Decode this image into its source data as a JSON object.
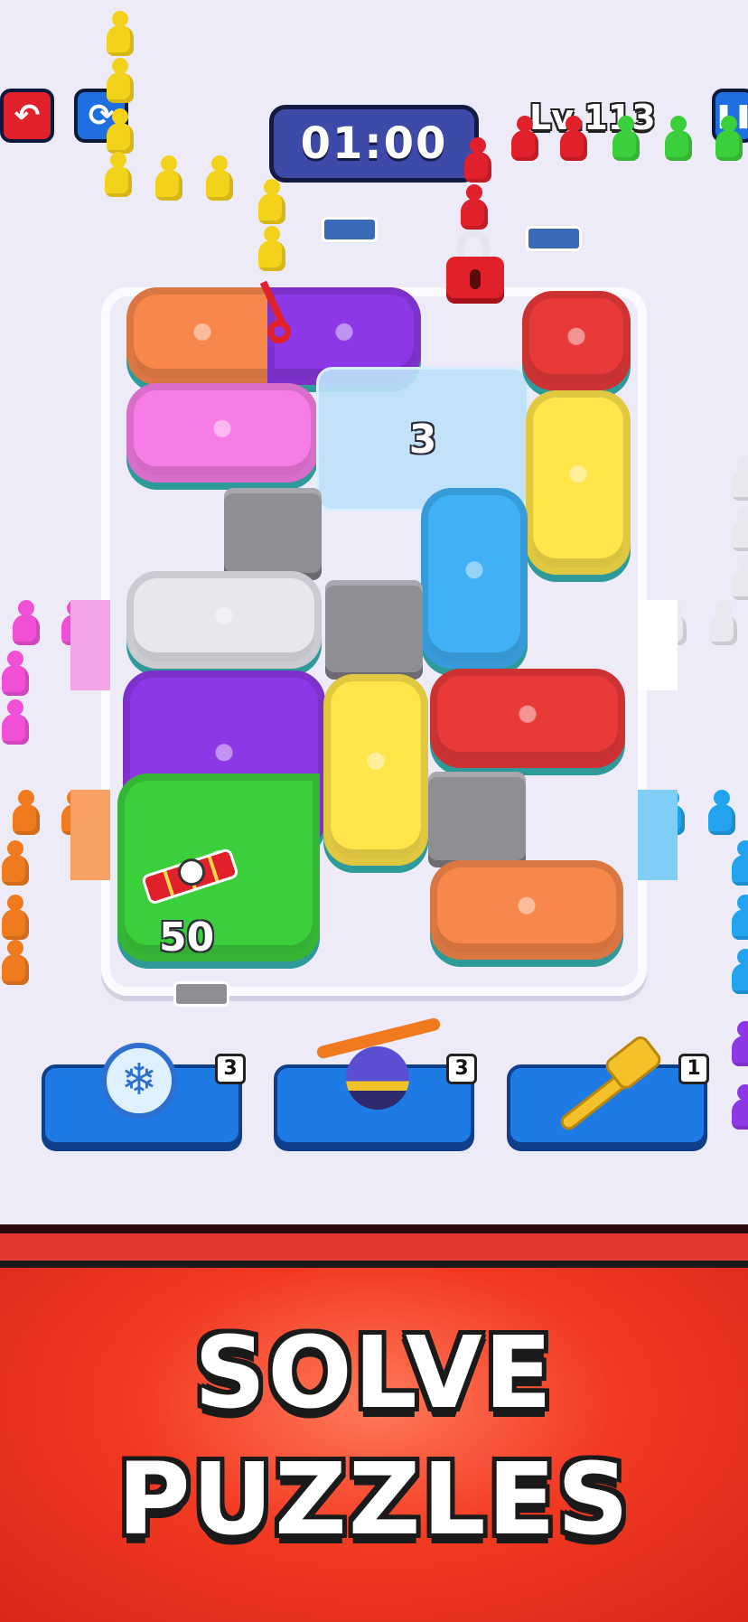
{
  "hud": {
    "timer": "01:00",
    "level": "Lv.113",
    "undo_icon": "undo-arrow-icon",
    "restart_icon": "restart-icon",
    "pause_icon": "pause-icon",
    "colors": {
      "undo": "#e0202a",
      "restart": "#1f6fe0",
      "timer_bg": "#3d4aa8"
    }
  },
  "board": {
    "frozen_bus_count": "3",
    "dynamite_bus_count": "50",
    "bus_colors": [
      "orange",
      "purple",
      "red",
      "pink",
      "yellow",
      "blue",
      "white",
      "purple",
      "yellow",
      "red",
      "green",
      "orange"
    ]
  },
  "boosters": [
    {
      "name": "freeze",
      "icon": "snowflake-clock-icon",
      "count": "3"
    },
    {
      "name": "propeller",
      "icon": "propeller-ball-icon",
      "count": "3"
    },
    {
      "name": "hammer",
      "icon": "hammer-icon",
      "count": "1"
    }
  ],
  "banner": {
    "line1": "SOLVE",
    "line2": "PUZZLES",
    "color": "#f23a22"
  }
}
